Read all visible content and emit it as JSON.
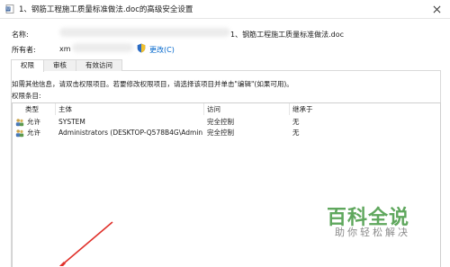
{
  "window": {
    "title": "1、钢筋工程施工质量标准做法.doc的高级安全设置",
    "close_glyph": "✕"
  },
  "properties": {
    "name_label": "名称:",
    "name_value": "1、钢筋工程施工质量标准做法.doc",
    "owner_label": "所有者:",
    "owner_value": "xm",
    "change_link": "更改(C)"
  },
  "tabs": [
    {
      "label": "权限",
      "active": true
    },
    {
      "label": "审核",
      "active": false
    },
    {
      "label": "有效访问",
      "active": false
    }
  ],
  "info_text": "如需其他信息，请双击权限项目。若要修改权限项目，请选择该项目并单击\"编辑\"(如果可用)。",
  "entries_label": "权限条目:",
  "table": {
    "columns": [
      "类型",
      "主体",
      "访问",
      "继承于"
    ],
    "rows": [
      {
        "type": "允许",
        "principal": "SYSTEM",
        "access": "完全控制",
        "inherited": "无"
      },
      {
        "type": "允许",
        "principal": "Administrators (DESKTOP-Q578B4G\\Administra...",
        "access": "完全控制",
        "inherited": "无"
      }
    ]
  },
  "watermark": {
    "title": "百科全说",
    "subtitle": "助你轻松解决"
  },
  "colors": {
    "link": "#0066cc",
    "watermark_green": "#5fa75d",
    "arrow_red": "#e0302a"
  },
  "icons": [
    "word-doc-icon",
    "close-icon",
    "shield-icon",
    "user-group-icon"
  ]
}
